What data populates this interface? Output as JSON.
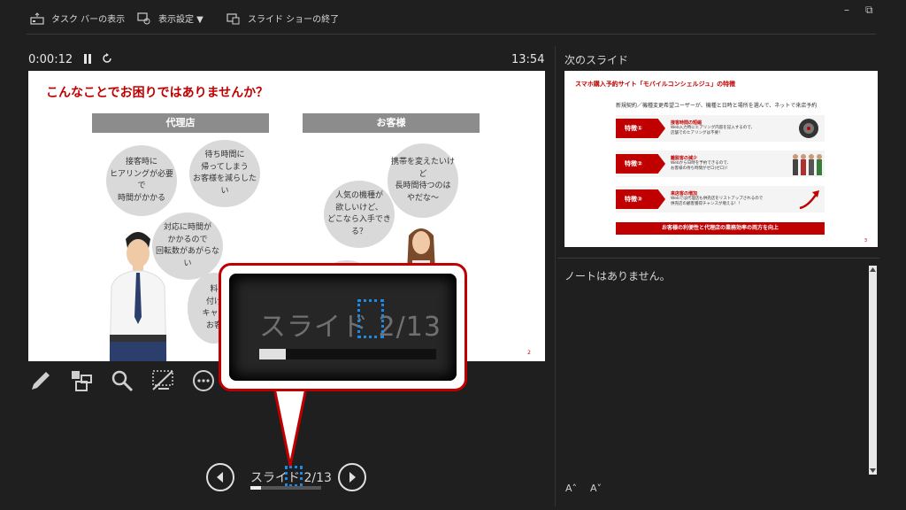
{
  "toolbar": {
    "taskbar_label": "タスク バーの表示",
    "display_settings_label": "表示設定 ▼",
    "end_slideshow_label": "スライド ショーの終了"
  },
  "window": {
    "minimize": "–",
    "restore": "⧉"
  },
  "timer": {
    "elapsed": "0:00:12",
    "clock": "13:54"
  },
  "next_slide": {
    "label": "次のスライド",
    "title": "スマホ購入予約サイト「モバイルコンシェルジュ」の特徴",
    "subtitle": "新規契約／機種変更希望ユーザーが、機種と日時と場所を選んで、ネットで来店予約",
    "rows": [
      {
        "tag": "特徴①",
        "heading": "接客時間の短縮",
        "desc": "Web入力時にヒアリング内容を記入するので、\n店舗でのヒアリングは不要！"
      },
      {
        "tag": "特徴②",
        "heading": "離脱客の減少",
        "desc": "Webから日時を予約できるので、\nお客様の待ち時間がゼロ(ゼロ)！"
      },
      {
        "tag": "特徴③",
        "heading": "来店客の増加",
        "desc": "Webでは代理店も併売店をリストアップされるので\n併売店の顧客獲得チャンスが増える！！"
      }
    ],
    "footer": "お客様の利便性と代理店の業務効率の両方を向上",
    "page": "3"
  },
  "current_slide": {
    "title": "こんなことでお困りではありませんか？",
    "left_header": "代理店",
    "right_header": "お客様",
    "bubbles": {
      "b1": "接客時に\nヒアリングが必要で\n時間がかかる",
      "b2": "待ち時間に\n帰ってしまう\nお客様を減らしたい",
      "b3": "対応に時間が\nかかるので\n回転数があがらない",
      "b4": "料\n付け\nキャリ\nお客",
      "b5": "携帯を変えたいけど\n長時間待つのは\nやだな～",
      "b6": "人気の機種が\n欲しいけど、\nどこなら入手できる？"
    },
    "page": "2"
  },
  "popup": {
    "prefix": "スライド ",
    "current": "2",
    "suffix": "/13",
    "progress": 0.15
  },
  "nav": {
    "prefix": "スライド ",
    "current": "2",
    "suffix": "/13",
    "progress": 0.15
  },
  "notes": {
    "text": "ノートはありません。"
  },
  "font_buttons": {
    "increase": "A˄",
    "decrease": "A˅"
  }
}
